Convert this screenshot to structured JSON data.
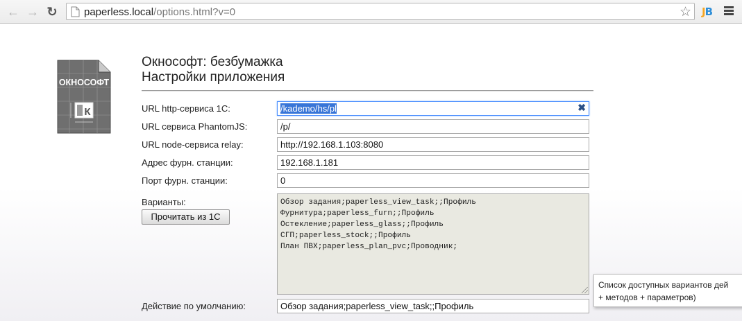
{
  "browser": {
    "back_icon": "arrow-left-icon",
    "forward_icon": "arrow-right-icon",
    "reload_icon": "reload-icon",
    "url_host": "paperless.local",
    "url_path": "/options.html?v=0",
    "bookmark_icon": "star-icon",
    "extension_label_j": "J",
    "extension_label_b": "B",
    "menu_icon": "hamburger-menu-icon"
  },
  "logo": {
    "text": "ОКНОСОФТ",
    "letter": "К"
  },
  "header": {
    "app_title": "Окнософт: безбумажка",
    "settings_title": "Настройки приложения"
  },
  "form": {
    "http_service": {
      "label": "URL http-сервиса 1С:",
      "value": "/kademo/hs/pl"
    },
    "phantomjs": {
      "label": "URL сервиса PhantomJS:",
      "value": "/p/"
    },
    "relay": {
      "label": "URL node-сервиса relay:",
      "value": "http://192.168.1.103:8080"
    },
    "station_address": {
      "label": "Адрес фурн. станции:",
      "value": "192.168.1.181"
    },
    "station_port": {
      "label": "Порт фурн. станции:",
      "value": "0"
    },
    "variants": {
      "label": "Варианты:",
      "button": "Прочитать из 1С",
      "lines": [
        "Обзор задания;paperless_view_task;;Профиль",
        "Фурнитура;paperless_furn;;Профиль",
        "Остекление;paperless_glass;;Профиль",
        "СГП;paperless_stock;;Профиль",
        "План ПВХ;paperless_plan_pvc;Проводник;"
      ]
    },
    "default_action": {
      "label": "Действие по умолчанию:",
      "value": "Обзор задания;paperless_view_task;;Профиль"
    }
  },
  "tooltip": {
    "line1": "Список доступных вариантов дей",
    "line2": "+ методов + параметров)"
  },
  "colors": {
    "focus_border": "#4d90fe",
    "selection": "#3875d7",
    "textarea_bg": "#e9e9e1"
  }
}
